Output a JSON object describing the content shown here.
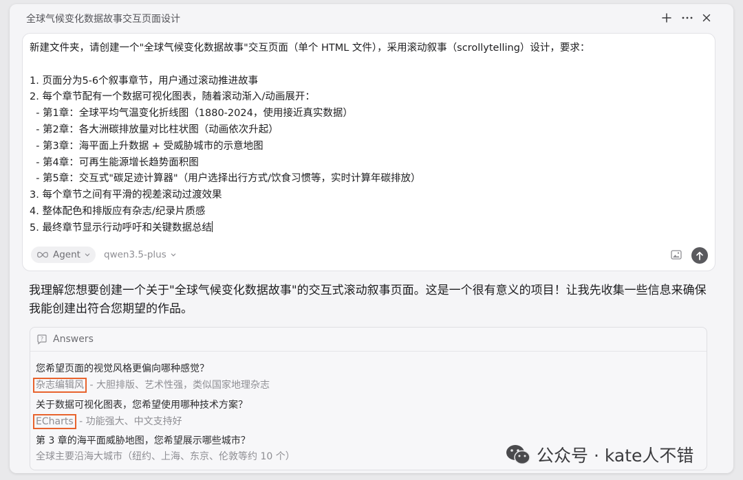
{
  "window": {
    "title": "全球气候变化数据故事交互页面设计"
  },
  "composer": {
    "prompt_lines": [
      "新建文件夹，请创建一个\"全球气候变化数据故事\"交互页面（单个 HTML 文件），采用滚动叙事（scrollytelling）设计，要求：",
      "",
      "1. 页面分为5-6个叙事章节，用户通过滚动推进故事",
      "2. 每个章节配有一个数据可视化图表，随着滚动渐入/动画展开：",
      "  - 第1章：全球平均气温变化折线图（1880-2024，使用接近真实数据）",
      "  - 第2章：各大洲碳排放量对比柱状图（动画依次升起）",
      "  - 第3章：海平面上升数据 + 受威胁城市的示意地图",
      "  - 第4章：可再生能源增长趋势面积图",
      "  - 第5章：交互式\"碳足迹计算器\"（用户选择出行方式/饮食习惯等，实时计算年碳排放）",
      "3. 每个章节之间有平滑的视差滚动过渡效果",
      "4. 整体配色和排版应有杂志/纪录片质感",
      "5. 最终章节显示行动呼吁和关键数据总结"
    ],
    "agent_label": "Agent",
    "model_label": "qwen3.5-plus"
  },
  "reply": {
    "text": "我理解您想要创建一个关于\"全球气候变化数据故事\"的交互式滚动叙事页面。这是一个很有意义的项目！让我先收集一些信息来确保我能创建出符合您期望的作品。"
  },
  "answers": {
    "header": "Answers",
    "items": [
      {
        "question": "您希望页面的视觉风格更偏向哪种感觉？",
        "answer": "杂志编辑风",
        "detail": " - 大胆排版、艺术性强，类似国家地理杂志",
        "highlighted": true
      },
      {
        "question": "关于数据可视化图表，您希望使用哪种技术方案？",
        "answer": "ECharts",
        "detail": " - 功能强大、中文支持好",
        "highlighted": true
      },
      {
        "question": "第 3 章的海平面威胁地图，您希望展示哪些城市？",
        "answer": "全球主要沿海大城市（纽约、上海、东京、伦敦等约 10 个）",
        "detail": "",
        "highlighted": false
      }
    ]
  },
  "watermark": {
    "text": "公众号 · kate人不错"
  }
}
